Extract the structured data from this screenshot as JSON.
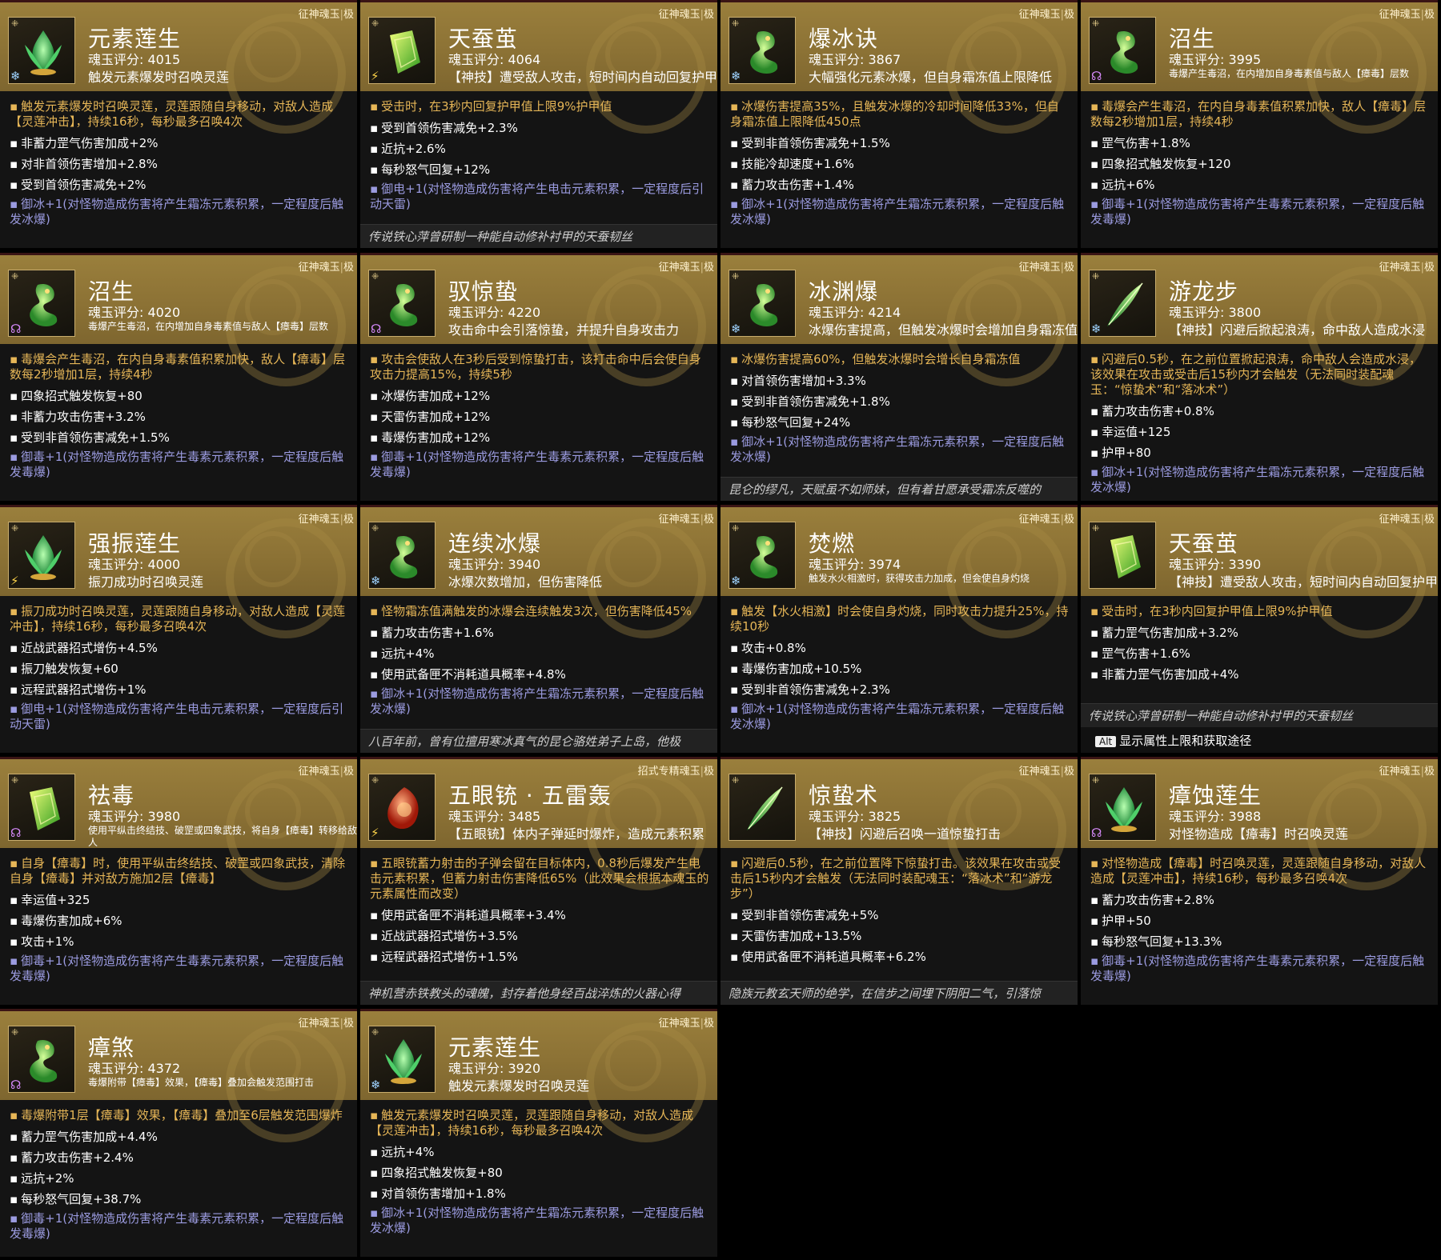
{
  "tag_sep": "|",
  "tag_grade": "极",
  "bullet": "▪",
  "cards": [
    {
      "tag": "征神魂玉",
      "name": "元素莲生",
      "score": "魂玉评分: 4015",
      "sub": "触发元素爆发时召唤灵莲",
      "element": "ice",
      "gem": "lotus",
      "main": "触发元素爆发时召唤灵莲，灵莲跟随自身移动，对敌人造成【灵莲冲击】，持续16秒，每秒最多召唤4次",
      "stats": [
        "非蓄力罡气伤害加成+2%",
        "对非首领伤害增加+2.8%",
        "受到首领伤害减免+2%"
      ],
      "set": "御冰+1(对怪物造成伤害将产生霜冻元素积累，一定程度后触发冰爆)",
      "flavor": ""
    },
    {
      "tag": "征神魂玉",
      "name": "天蚕茧",
      "score": "魂玉评分: 4064",
      "sub": "【神技】遭受敌人攻击，短时间内自动回复护甲值",
      "element": "thunder",
      "gem": "cocoon",
      "main": "受击时，在3秒内回复护甲值上限9%护甲值",
      "stats": [
        "受到首领伤害减免+2.3%",
        "近抗+2.6%",
        "每秒怒气回复+12%"
      ],
      "set": "御电+1(对怪物造成伤害将产生电击元素积累，一定程度后引动天雷)",
      "flavor": "传说铁心萍曾研制一种能自动修补衬甲的天蚕韧丝"
    },
    {
      "tag": "征神魂玉",
      "name": "爆冰诀",
      "score": "魂玉评分: 3867",
      "sub": "大幅强化元素冰爆，但自身霜冻值上限降低",
      "element": "ice",
      "gem": "dragon",
      "main": "冰爆伤害提高35%，且触发冰爆的冷却时间降低33%，但自身霜冻值上限降低450点",
      "stats": [
        "受到非首领伤害减免+1.5%",
        "技能冷却速度+1.6%",
        "蓄力攻击伤害+1.4%"
      ],
      "set": "御冰+1(对怪物造成伤害将产生霜冻元素积累，一定程度后触发冰爆)",
      "flavor": ""
    },
    {
      "tag": "征神魂玉",
      "name": "沼生",
      "score": "魂玉评分: 3995",
      "sub": "毒爆产生毒沼，在内增加自身毒素值与敌人【瘴毒】层数",
      "subSmall": true,
      "element": "poison",
      "gem": "dragon",
      "main": "毒爆会产生毒沼，在内自身毒素值积累加快，敌人【瘴毒】层数每2秒增加1层，持续4秒",
      "stats": [
        "罡气伤害+1.8%",
        "四象招式触发恢复+120",
        "远抗+6%"
      ],
      "set": "御毒+1(对怪物造成伤害将产生毒素元素积累，一定程度后触发毒爆)",
      "flavor": ""
    },
    {
      "tag": "征神魂玉",
      "name": "沼生",
      "score": "魂玉评分: 4020",
      "sub": "毒爆产生毒沼，在内增加自身毒素值与敌人【瘴毒】层数",
      "subSmall": true,
      "element": "poison",
      "gem": "dragon",
      "main": "毒爆会产生毒沼，在内自身毒素值积累加快，敌人【瘴毒】层数每2秒增加1层，持续4秒",
      "stats": [
        "四象招式触发恢复+80",
        "非蓄力攻击伤害+3.2%",
        "受到非首领伤害减免+1.5%"
      ],
      "set": "御毒+1(对怪物造成伤害将产生毒素元素积累，一定程度后触发毒爆)",
      "flavor": ""
    },
    {
      "tag": "征神魂玉",
      "name": "驭惊蛰",
      "score": "魂玉评分: 4220",
      "sub": "攻击命中会引落惊蛰，并提升自身攻击力",
      "element": "poison",
      "gem": "dragon",
      "main": "攻击会使敌人在3秒后受到惊蛰打击，该打击命中后会使自身攻击力提高15%，持续5秒",
      "stats": [
        "冰爆伤害加成+12%",
        "天雷伤害加成+12%",
        "毒爆伤害加成+12%"
      ],
      "set": "御毒+1(对怪物造成伤害将产生毒素元素积累，一定程度后触发毒爆)",
      "flavor": ""
    },
    {
      "tag": "征神魂玉",
      "name": "冰渊爆",
      "score": "魂玉评分: 4214",
      "sub": "冰爆伤害提高，但触发冰爆时会增加自身霜冻值",
      "element": "ice",
      "gem": "dragon",
      "main": "冰爆伤害提高60%，但触发冰爆时会增长自身霜冻值",
      "stats": [
        "对首领伤害增加+3.3%",
        "受到非首领伤害减免+1.8%",
        "每秒怒气回复+24%"
      ],
      "set": "御冰+1(对怪物造成伤害将产生霜冻元素积累，一定程度后触发冰爆)",
      "flavor": "昆仑的缪凡，天赋虽不如师妹，但有着甘愿承受霜冻反噬的"
    },
    {
      "tag": "征神魂玉",
      "name": "游龙步",
      "score": "魂玉评分: 3800",
      "sub": "【神技】闪避后掀起浪涛，命中敌人造成水浸",
      "element": "ice",
      "gem": "feather",
      "main": "闪避后0.5秒，在之前位置掀起浪涛，命中敌人会造成水浸，该效果在攻击或受击后15秒内才会触发（无法同时装配魂玉：“惊蛰术”和“落冰术”）",
      "stats": [
        "蓄力攻击伤害+0.8%",
        "幸运值+125",
        "护甲+80"
      ],
      "set": "御冰+1(对怪物造成伤害将产生霜冻元素积累，一定程度后触发冰爆)",
      "flavor": ""
    },
    {
      "tag": "征神魂玉",
      "name": "强振莲生",
      "score": "魂玉评分: 4000",
      "sub": "振刀成功时召唤灵莲",
      "element": "thunder",
      "gem": "lotus",
      "main": "振刀成功时召唤灵莲，灵莲跟随自身移动，对敌人造成【灵莲冲击】，持续16秒，每秒最多召唤4次",
      "stats": [
        "近战武器招式增伤+4.5%",
        "振刀触发恢复+60",
        "远程武器招式增伤+1%"
      ],
      "set": "御电+1(对怪物造成伤害将产生电击元素积累，一定程度后引动天雷)",
      "flavor": ""
    },
    {
      "tag": "征神魂玉",
      "name": "连续冰爆",
      "score": "魂玉评分: 3940",
      "sub": "冰爆次数增加，但伤害降低",
      "element": "ice",
      "gem": "dragon",
      "main": "怪物霜冻值满触发的冰爆会连续触发3次，但伤害降低45%",
      "stats": [
        "蓄力攻击伤害+1.6%",
        "远抗+4%",
        "使用武备匣不消耗道具概率+4.8%"
      ],
      "set": "御冰+1(对怪物造成伤害将产生霜冻元素积累，一定程度后触发冰爆)",
      "flavor": "八百年前，曾有位擅用寒冰真气的昆仑骆姓弟子上岛，他极"
    },
    {
      "tag": "征神魂玉",
      "name": "焚燃",
      "score": "魂玉评分: 3974",
      "sub": "触发水火相激时，获得攻击力加成，但会使自身灼烧",
      "subSmall": true,
      "element": "ice",
      "gem": "dragon",
      "main": "触发【水火相激】时会使自身灼烧，同时攻击力提升25%，持续10秒",
      "stats": [
        "攻击+0.8%",
        "毒爆伤害加成+10.5%",
        "受到非首领伤害减免+2.3%"
      ],
      "set": "御冰+1(对怪物造成伤害将产生霜冻元素积累，一定程度后触发冰爆)",
      "flavor": ""
    },
    {
      "tag": "征神魂玉",
      "name": "天蚕茧",
      "score": "魂玉评分: 3390",
      "sub": "【神技】遭受敌人攻击，短时间内自动回复护甲值",
      "element": "",
      "gem": "cocoon",
      "main": "受击时，在3秒内回复护甲值上限9%护甲值",
      "stats": [
        "蓄力罡气伤害加成+3.2%",
        "罡气伤害+1.6%",
        "非蓄力罡气伤害加成+4%"
      ],
      "set": "",
      "flavor": "传说铁心萍曾研制一种能自动修补衬甲的天蚕韧丝",
      "alt": true
    },
    {
      "tag": "征神魂玉",
      "name": "祛毒",
      "score": "魂玉评分: 3980",
      "sub": "使用平纵击终结技、破罡或四象武技，将自身【瘴毒】转移给敌人",
      "subSmall": true,
      "element": "poison",
      "gem": "cocoon",
      "main": "自身【瘴毒】时，使用平纵击终结技、破罡或四象武技，清除自身【瘴毒】并对敌方施加2层【瘴毒】",
      "stats": [
        "幸运值+325",
        "毒爆伤害加成+6%",
        "攻击+1%"
      ],
      "set": "御毒+1(对怪物造成伤害将产生毒素元素积累，一定程度后触发毒爆)",
      "flavor": ""
    },
    {
      "tag": "招式专精魂玉",
      "name": "五眼铳 · 五雷轰",
      "score": "魂玉评分: 3485",
      "sub": "【五眼铳】体内子弹延时爆炸，造成元素积累",
      "element": "thunder",
      "gem": "red",
      "main": "五眼铳蓄力射击的子弹会留在目标体内，0.8秒后爆发产生电击元素积累，但蓄力射击伤害降低65%（此效果会根据本魂玉的元素属性而改变）",
      "stats": [
        "使用武备匣不消耗道具概率+3.4%",
        "近战武器招式增伤+3.5%",
        "远程武器招式增伤+1.5%"
      ],
      "set": "",
      "flavor": "神机营赤铁教头的魂魄，封存着他身经百战淬炼的火器心得"
    },
    {
      "tag": "征神魂玉",
      "name": "惊蛰术",
      "score": "魂玉评分: 3825",
      "sub": "【神技】闪避后召唤一道惊蛰打击",
      "element": "",
      "gem": "feather",
      "main": "闪避后0.5秒，在之前位置降下惊蛰打击。该效果在攻击或受击后15秒内才会触发（无法同时装配魂玉：“落冰术”和“游龙步”）",
      "stats": [
        "受到非首领伤害减免+5%",
        "天雷伤害加成+13.5%",
        "使用武备匣不消耗道具概率+6.2%"
      ],
      "set": "",
      "flavor": "隐族元教玄天师的绝学，在信步之间埋下阴阳二气，引落惊"
    },
    {
      "tag": "征神魂玉",
      "name": "瘴蚀莲生",
      "score": "魂玉评分: 3988",
      "sub": "对怪物造成【瘴毒】时召唤灵莲",
      "element": "poison",
      "gem": "lotus",
      "main": "对怪物造成【瘴毒】时召唤灵莲，灵莲跟随自身移动，对敌人造成【灵莲冲击】，持续16秒，每秒最多召唤4次",
      "stats": [
        "蓄力攻击伤害+2.8%",
        "护甲+50",
        "每秒怒气回复+13.3%"
      ],
      "set": "御毒+1(对怪物造成伤害将产生毒素元素积累，一定程度后触发毒爆)",
      "flavor": ""
    },
    {
      "tag": "征神魂玉",
      "name": "瘴煞",
      "score": "魂玉评分: 4372",
      "sub": "毒爆附带【瘴毒】效果，【瘴毒】叠加会触发范围打击",
      "subSmall": true,
      "element": "poison",
      "gem": "dragon",
      "main": "毒爆附带1层【瘴毒】效果，【瘴毒】叠加至6层触发范围爆炸",
      "stats": [
        "蓄力罡气伤害加成+4.4%",
        "蓄力攻击伤害+2.4%",
        "远抗+2%",
        "每秒怒气回复+38.7%"
      ],
      "set": "御毒+1(对怪物造成伤害将产生毒素元素积累，一定程度后触发毒爆)",
      "flavor": ""
    },
    {
      "tag": "征神魂玉",
      "name": "元素莲生",
      "score": "魂玉评分: 3920",
      "sub": "触发元素爆发时召唤灵莲",
      "element": "ice",
      "gem": "lotus",
      "main": "触发元素爆发时召唤灵莲，灵莲跟随自身移动，对敌人造成【灵莲冲击】，持续16秒，每秒最多召唤4次",
      "stats": [
        "远抗+4%",
        "四象招式触发恢复+80",
        "对首领伤害增加+1.8%"
      ],
      "set": "御冰+1(对怪物造成伤害将产生霜冻元素积累，一定程度后触发冰爆)",
      "flavor": ""
    }
  ],
  "alt_key": "Alt",
  "alt_text": "显示属性上限和获取途径",
  "icons": {
    "ice": "snowflake-icon",
    "thunder": "lightning-icon",
    "poison": "poison-bubble-icon"
  }
}
